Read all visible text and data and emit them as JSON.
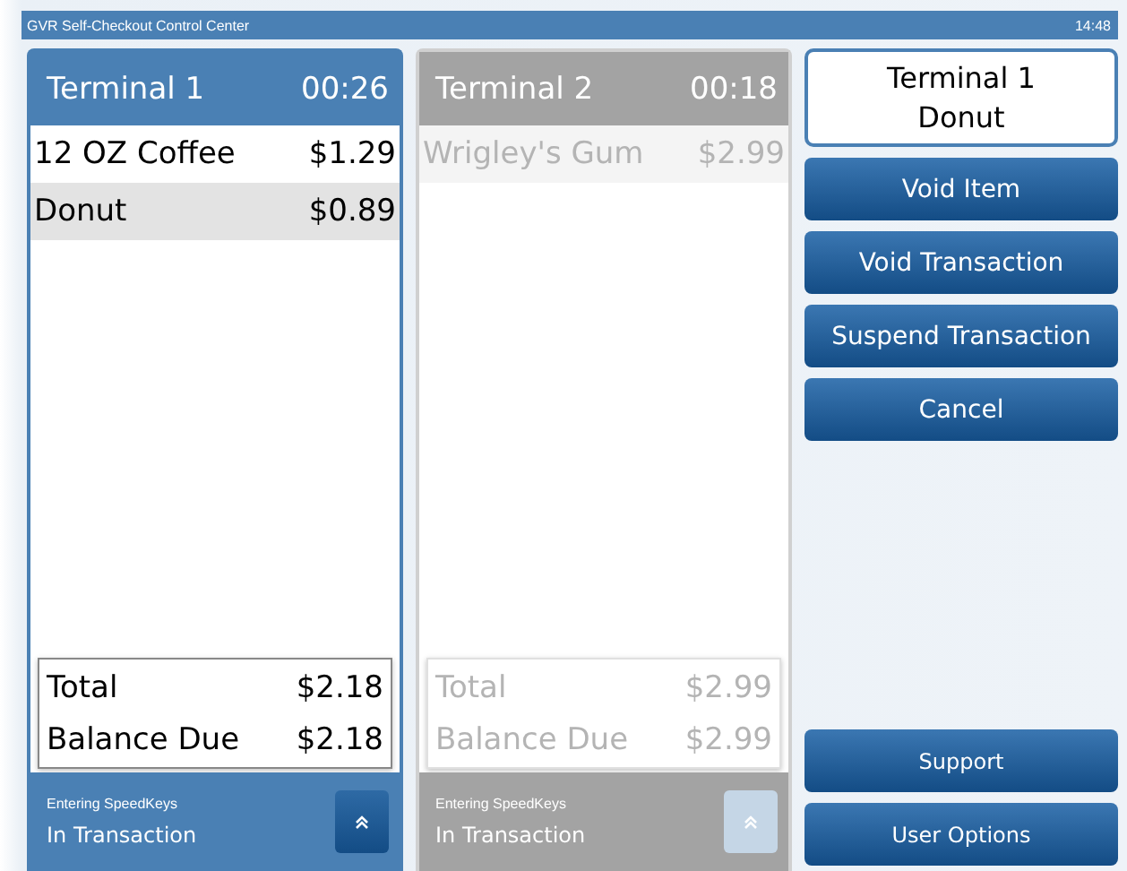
{
  "window": {
    "title": "GVR Self-Checkout Control Center",
    "clock": "14:48"
  },
  "terminals": [
    {
      "name": "Terminal 1",
      "timer": "00:26",
      "selected": true,
      "items": [
        {
          "name": "12 OZ Coffee",
          "price": "$1.29",
          "selected": false
        },
        {
          "name": "Donut",
          "price": "$0.89",
          "selected": true
        }
      ],
      "totals": [
        {
          "label": "Total",
          "value": "$2.18"
        },
        {
          "label": "Balance Due",
          "value": "$2.18"
        }
      ],
      "mode": "Entering SpeedKeys",
      "status": "In Transaction"
    },
    {
      "name": "Terminal 2",
      "timer": "00:18",
      "selected": false,
      "items": [
        {
          "name": "Wrigley's Gum",
          "price": "$2.99",
          "selected": false
        }
      ],
      "totals": [
        {
          "label": "Total",
          "value": "$2.99"
        },
        {
          "label": "Balance Due",
          "value": "$2.99"
        }
      ],
      "mode": "Entering SpeedKeys",
      "status": "In Transaction"
    }
  ],
  "selection": {
    "terminal": "Terminal 1",
    "item": "Donut"
  },
  "actions": [
    "Void Item",
    "Void Transaction",
    "Suspend Transaction",
    "Cancel"
  ],
  "bottom_actions": [
    "Support",
    "User Options"
  ]
}
